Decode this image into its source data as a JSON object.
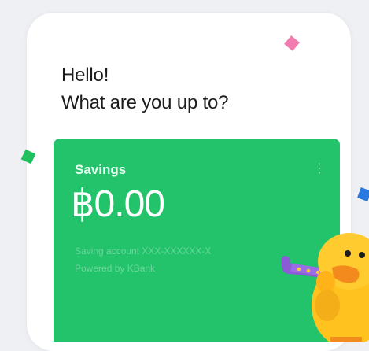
{
  "greeting": {
    "line1": "Hello!",
    "line2": "What are you up to?"
  },
  "account_card": {
    "title": "Savings",
    "balance": "฿0.00",
    "info_line1": "Saving account XXX-XXXXXX-X",
    "info_line2": "Powered by KBank",
    "menu_icon": "more-vertical-icon",
    "color": "#22c36a"
  },
  "decorations": {
    "confetti_colors": [
      "#f17cb0",
      "#1fc05e",
      "#2a79e0"
    ],
    "mascot": "duck-character-with-party-horn"
  }
}
